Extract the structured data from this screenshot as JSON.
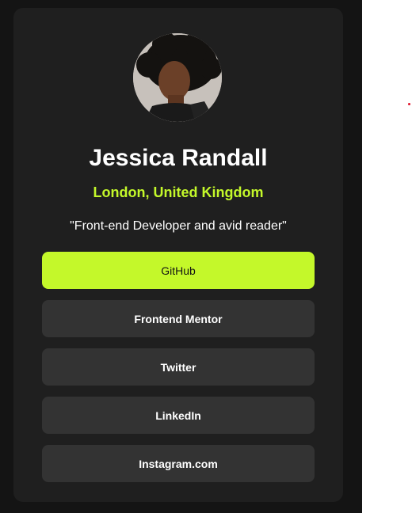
{
  "profile": {
    "name": "Jessica Randall",
    "location": "London, United Kingdom",
    "bio": "\"Front-end Developer and avid reader\""
  },
  "links": [
    {
      "label": "GitHub"
    },
    {
      "label": "Frontend Mentor"
    },
    {
      "label": "Twitter"
    },
    {
      "label": "LinkedIn"
    },
    {
      "label": "Instagram.com"
    }
  ],
  "colors": {
    "page_background": "#141414",
    "card_background": "#1f1f1f",
    "accent": "#c4f82a",
    "link_background": "#333333"
  }
}
